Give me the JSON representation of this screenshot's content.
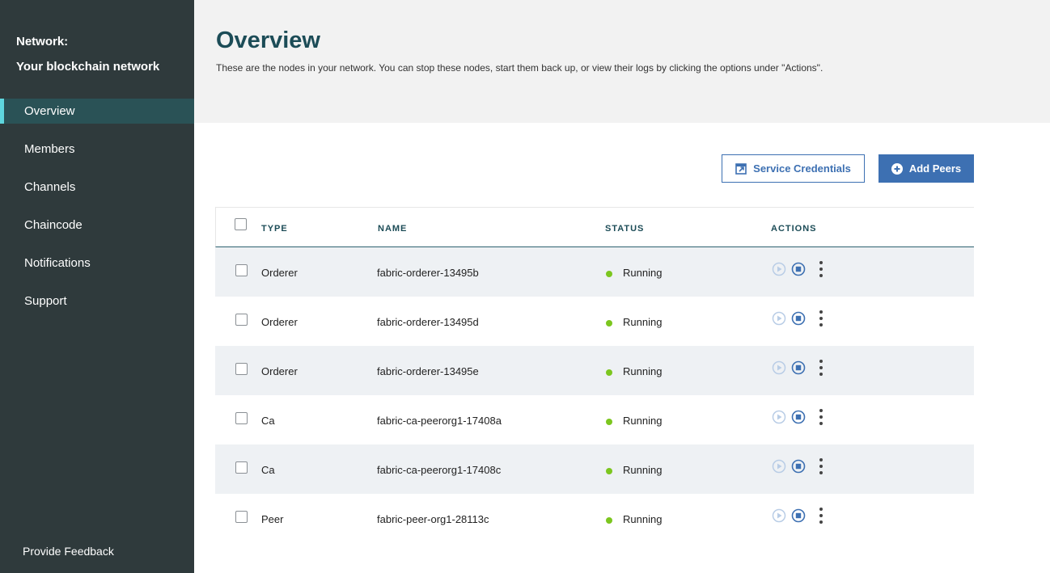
{
  "sidebar": {
    "title_line1": "Network:",
    "title_line2": "Your blockchain network",
    "items": [
      {
        "label": "Overview"
      },
      {
        "label": "Members"
      },
      {
        "label": "Channels"
      },
      {
        "label": "Chaincode"
      },
      {
        "label": "Notifications"
      },
      {
        "label": "Support"
      }
    ],
    "feedback": "Provide Feedback"
  },
  "header": {
    "title": "Overview",
    "description": "These are the nodes in your network. You can stop these nodes, start them back up, or view their logs by clicking the options under \"Actions\"."
  },
  "toolbar": {
    "credentials_label": "Service Credentials",
    "add_peers_label": "Add Peers"
  },
  "table": {
    "columns": [
      "TYPE",
      "NAME",
      "STATUS",
      "ACTIONS"
    ],
    "rows": [
      {
        "type": "Orderer",
        "name": "fabric-orderer-13495b",
        "status": "Running"
      },
      {
        "type": "Orderer",
        "name": "fabric-orderer-13495d",
        "status": "Running"
      },
      {
        "type": "Orderer",
        "name": "fabric-orderer-13495e",
        "status": "Running"
      },
      {
        "type": "Ca",
        "name": "fabric-ca-peerorg1-17408a",
        "status": "Running"
      },
      {
        "type": "Ca",
        "name": "fabric-ca-peerorg1-17408c",
        "status": "Running"
      },
      {
        "type": "Peer",
        "name": "fabric-peer-org1-28113c",
        "status": "Running"
      }
    ]
  },
  "colors": {
    "sidebar_bg": "#2f3a3c",
    "active_accent": "#5ed6de",
    "primary": "#3d70b2",
    "status_running": "#7cc61f"
  }
}
